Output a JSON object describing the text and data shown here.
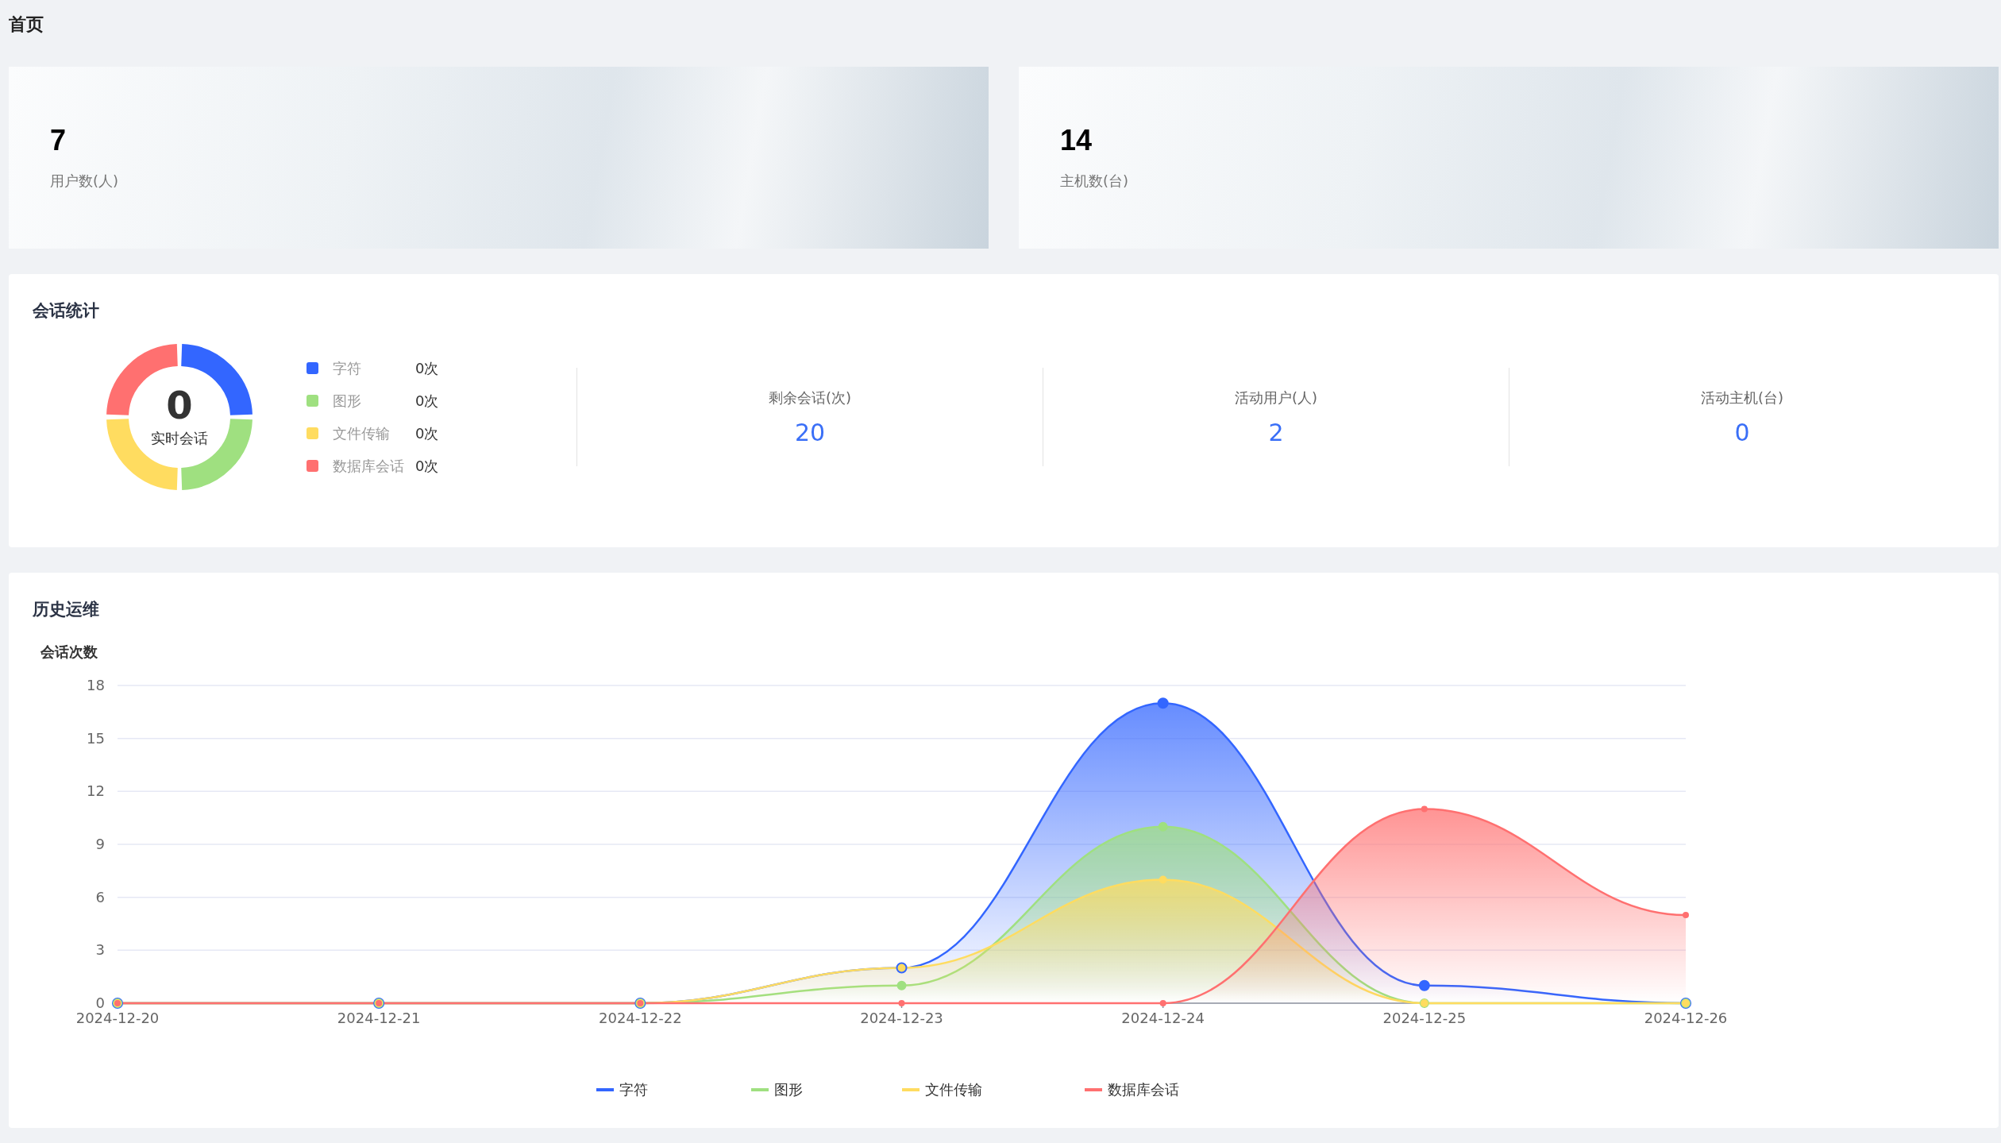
{
  "page_title": "首页",
  "summary_cards": [
    {
      "value": "7",
      "label": "用户数(人)"
    },
    {
      "value": "14",
      "label": "主机数(台)"
    }
  ],
  "session_stats": {
    "title": "会话统计",
    "donut": {
      "value": "0",
      "label": "实时会话"
    },
    "legend": [
      {
        "name": "字符",
        "count": "0次",
        "color": "#3366ff"
      },
      {
        "name": "图形",
        "count": "0次",
        "color": "#9fe080"
      },
      {
        "name": "文件传输",
        "count": "0次",
        "color": "#ffdc60"
      },
      {
        "name": "数据库会话",
        "count": "0次",
        "color": "#ff7070"
      }
    ],
    "metrics": [
      {
        "label": "剩余会话(次)",
        "value": "20"
      },
      {
        "label": "活动用户(人)",
        "value": "2"
      },
      {
        "label": "活动主机(台)",
        "value": "0"
      }
    ]
  },
  "history": {
    "title": "历史运维",
    "chart_data": {
      "type": "area",
      "grid": true,
      "legend": "bottom",
      "ylabel": "会话次数",
      "categories": [
        "2024-12-20",
        "2024-12-21",
        "2024-12-22",
        "2024-12-23",
        "2024-12-24",
        "2024-12-25",
        "2024-12-26"
      ],
      "ylim": [
        0,
        18
      ],
      "yticks": [
        0,
        3,
        6,
        9,
        12,
        15,
        18
      ],
      "series": [
        {
          "name": "字符",
          "color": "#3366ff",
          "values": [
            0,
            0,
            0,
            2,
            17,
            1,
            0
          ]
        },
        {
          "name": "图形",
          "color": "#9fe080",
          "values": [
            0,
            0,
            0,
            1,
            10,
            0,
            0
          ]
        },
        {
          "name": "文件传输",
          "color": "#ffdc60",
          "values": [
            0,
            0,
            0,
            2,
            7,
            0,
            0
          ]
        },
        {
          "name": "数据库会话",
          "color": "#ff7070",
          "values": [
            0,
            0,
            0,
            0,
            0,
            11,
            5
          ]
        }
      ]
    }
  }
}
